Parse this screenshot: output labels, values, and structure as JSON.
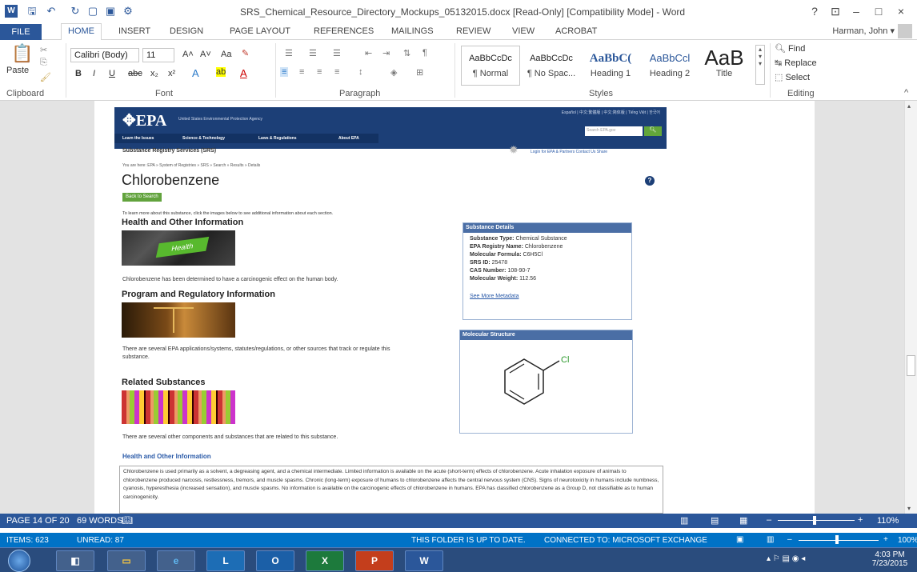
{
  "titlebar": {
    "title": "SRS_Chemical_Resource_Directory_Mockups_05132015.docx [Read-Only] [Compatibility Mode] - Word",
    "help": "?",
    "minimize": "–",
    "restore": "□",
    "close": "×"
  },
  "tabs": [
    "FILE",
    "HOME",
    "INSERT",
    "DESIGN",
    "PAGE LAYOUT",
    "REFERENCES",
    "MAILINGS",
    "REVIEW",
    "VIEW",
    "ACROBAT"
  ],
  "user": "Harman, John",
  "ribbon": {
    "clipboard": {
      "paste": "Paste",
      "group": "Clipboard"
    },
    "font": {
      "name": "Calibri (Body)",
      "size": "11",
      "group": "Font",
      "bold": "B",
      "italic": "I",
      "underline": "U",
      "strike": "abc",
      "sub": "x₂",
      "sup": "x²",
      "grow": "A˄",
      "shrink": "A˅",
      "case": "Aa"
    },
    "paragraph": {
      "group": "Paragraph"
    },
    "styles": {
      "group": "Styles",
      "items": [
        {
          "sample": "AaBbCcDc",
          "name": "¶ Normal"
        },
        {
          "sample": "AaBbCcDc",
          "name": "¶ No Spac..."
        },
        {
          "sample": "AaBbC(",
          "name": "Heading 1"
        },
        {
          "sample": "AaBbCcl",
          "name": "Heading 2"
        },
        {
          "sample": "AaB",
          "name": "Title"
        }
      ]
    },
    "editing": {
      "group": "Editing",
      "find": "Find",
      "replace": "Replace",
      "select": "Select"
    }
  },
  "epa": {
    "logo": "EPA",
    "agency": "United States Environmental Protection Agency",
    "languages": "Español  |  中文:繁體版  |  中文:简体版  |  Tiếng Việt  |  한국어",
    "search_placeholder": "Search EPA.gov",
    "nav": [
      "Learn the Issues",
      "Science & Technology",
      "Laws & Regulations",
      "About EPA"
    ],
    "site_name": "Substance Registry Services (SRS)",
    "top_links": "Login for EPA & Partners   Contact Us   Share",
    "breadcrumb": "You are here: EPA » System of Registries » SRS » Search » Results » Details",
    "heading": "Chlorobenzene",
    "back": "Back to Search",
    "intro": "To learn more about this substance, click the images below to see additional information about each section.",
    "sec1_title": "Health and Other Information",
    "sec1_text": "Chlorobenzene has been determined to have a carcinogenic effect on the human body.",
    "sec2_title": "Program and Regulatory Information",
    "sec2_text": "There are several EPA applications/systems, statutes/regulations, or other sources that track or regulate this substance.",
    "sec3_title": "Related Substances",
    "sec3_text": "There are several other components and substances that are related to this substance.",
    "sec4_title": "Health and Other Information",
    "sec4_text": "Chlorobenzene is used primarily as a solvent, a degreasing agent, and a chemical intermediate. Limited information is available on the acute (short-term) effects of chlorobenzene. Acute inhalation exposure of animals to chlorobenzene produced narcosis, restlessness, tremors, and muscle spasms. Chronic (long-term) exposure of humans to chlorobenzene affects the central nervous system (CNS). Signs of neurotoxicity in humans include numbness, cyanosis, hyperesthesia (increased sensation), and muscle spasms. No information is available on the carcinogenic effects of chlorobenzene in humans. EPA has classified chlorobenzene as a Group D, not classifiable as to human carcinogenicity.",
    "details_title": "Substance Details",
    "details": [
      {
        "k": "Substance Type:",
        "v": "Chemical Substance"
      },
      {
        "k": "EPA Registry Name:",
        "v": "Chlorobenzene"
      },
      {
        "k": "Molecular Formula:",
        "v": "C6H5Cl"
      },
      {
        "k": "SRS ID:",
        "v": "25478"
      },
      {
        "k": "CAS Number:",
        "v": "108-90-7"
      },
      {
        "k": "Molecular Weight:",
        "v": "112.56"
      }
    ],
    "see_more": "See More Metadata",
    "structure_title": "Molecular Structure",
    "structure_label": "Cl",
    "health_img_label": "Health"
  },
  "status": {
    "page": "PAGE 14 OF 20",
    "words": "69 WORDS",
    "zoom": "110%"
  },
  "outlook": {
    "items": "ITEMS: 623",
    "unread": "UNREAD: 87",
    "folder": "THIS FOLDER IS UP TO DATE.",
    "connected": "CONNECTED TO: MICROSOFT EXCHANGE",
    "zoom": "100%"
  },
  "taskbar": {
    "time": "4:03 PM",
    "date": "7/23/2015",
    "apps": [
      "Lync",
      "Outlook",
      "Excel",
      "PowerPoint",
      "Word"
    ]
  }
}
